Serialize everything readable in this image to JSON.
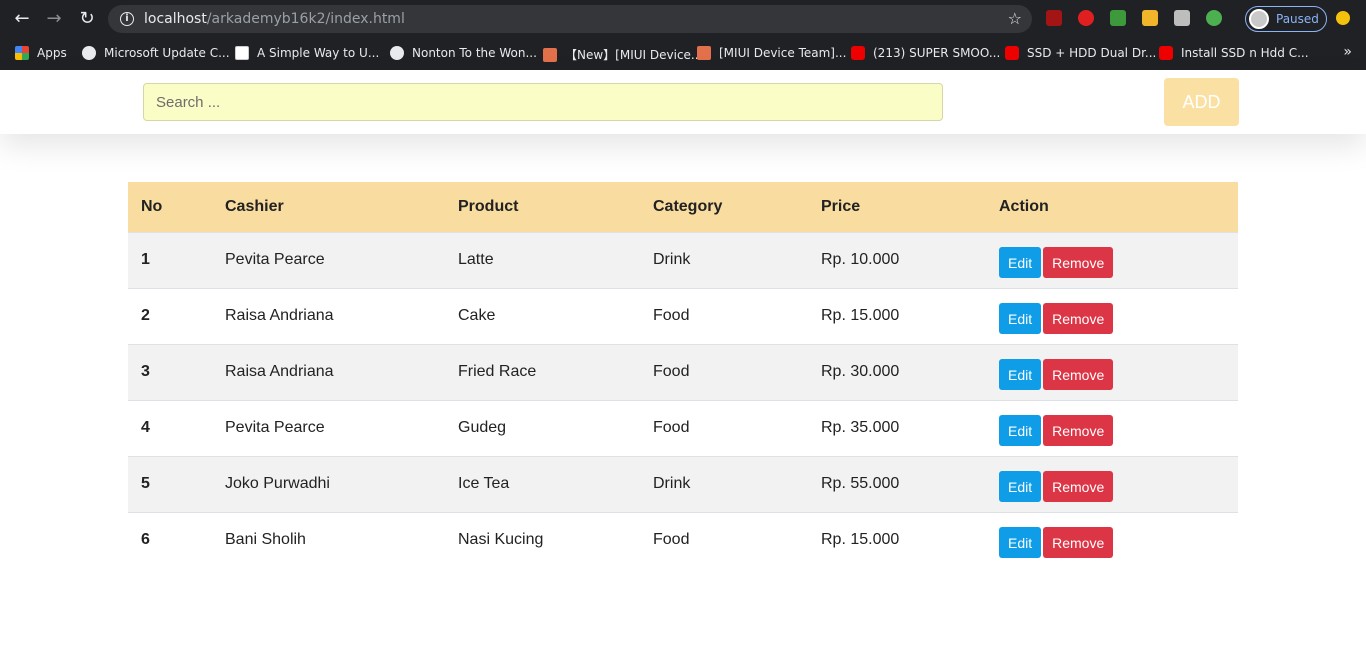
{
  "browser": {
    "url_host": "localhost",
    "url_path": "/arkademyb16k2/index.html",
    "profile_label": "Paused",
    "bookmarks": [
      {
        "label": "Apps",
        "icon": "apps-icon"
      },
      {
        "label": "Microsoft Update C...",
        "icon": "globe-icon"
      },
      {
        "label": "A Simple Way to U...",
        "icon": "site-icon"
      },
      {
        "label": "Nonton To the Won...",
        "icon": "globe-icon"
      },
      {
        "label": "【New】[MIUI Device...",
        "icon": "miui-icon"
      },
      {
        "label": "[MIUI Device Team]...",
        "icon": "miui-icon"
      },
      {
        "label": "(213) SUPER SMOO...",
        "icon": "youtube-icon"
      },
      {
        "label": "SSD + HDD Dual Dr...",
        "icon": "youtube-icon"
      },
      {
        "label": "Install SSD n Hdd C...",
        "icon": "youtube-icon"
      }
    ]
  },
  "header": {
    "search_placeholder": "Search ...",
    "add_label": "ADD"
  },
  "table": {
    "columns": [
      "No",
      "Cashier",
      "Product",
      "Category",
      "Price",
      "Action"
    ],
    "rows": [
      {
        "no": "1",
        "cashier": "Pevita Pearce",
        "product": "Latte",
        "category": "Drink",
        "price": "Rp. 10.000"
      },
      {
        "no": "2",
        "cashier": "Raisa Andriana",
        "product": "Cake",
        "category": "Food",
        "price": "Rp. 15.000"
      },
      {
        "no": "3",
        "cashier": "Raisa Andriana",
        "product": "Fried Race",
        "category": "Food",
        "price": "Rp. 30.000"
      },
      {
        "no": "4",
        "cashier": "Pevita Pearce",
        "product": "Gudeg",
        "category": "Food",
        "price": "Rp. 35.000"
      },
      {
        "no": "5",
        "cashier": "Joko Purwadhi",
        "product": "Ice Tea",
        "category": "Drink",
        "price": "Rp. 55.000"
      },
      {
        "no": "6",
        "cashier": "Bani Sholih",
        "product": "Nasi Kucing",
        "category": "Food",
        "price": "Rp. 15.000"
      }
    ],
    "edit_label": "Edit",
    "remove_label": "Remove"
  },
  "colors": {
    "header_row": "#f9dca0",
    "search_bg": "#fbfdc6",
    "add_button": "#fbe0a4",
    "edit_button": "#0f9de8",
    "remove_button": "#dc3545"
  }
}
